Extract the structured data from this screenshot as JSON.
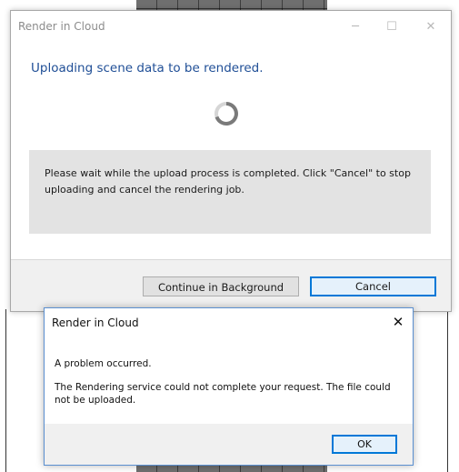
{
  "main_dialog": {
    "title": "Render in Cloud",
    "window_controls": {
      "minimize": "─",
      "maximize": "☐",
      "close": "✕"
    },
    "heading": "Uploading scene data to be rendered.",
    "message": "Please wait while the upload process is completed. Click \"Cancel\" to stop uploading and cancel the rendering job.",
    "buttons": {
      "continue_background": "Continue in Background",
      "cancel": "Cancel"
    }
  },
  "error_dialog": {
    "title": "Render in Cloud",
    "close_glyph": "✕",
    "line1": "A problem occurred.",
    "line2": "The Rendering service could not complete your request. The file could not be uploaded.",
    "ok_label": "OK"
  },
  "colors": {
    "heading": "#1f4e96",
    "accent": "#0078d7",
    "spinner": "#7a7a7a"
  },
  "icons": {
    "spinner": "loading-spinner-icon"
  }
}
